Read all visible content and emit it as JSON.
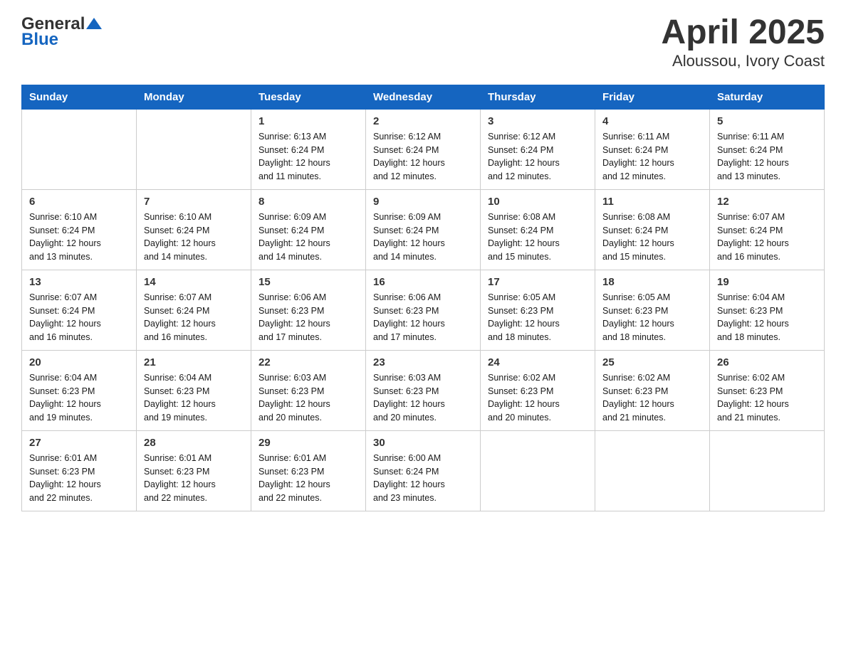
{
  "header": {
    "logo_general": "General",
    "logo_blue": "Blue",
    "title": "April 2025",
    "subtitle": "Aloussou, Ivory Coast"
  },
  "days_of_week": [
    "Sunday",
    "Monday",
    "Tuesday",
    "Wednesday",
    "Thursday",
    "Friday",
    "Saturday"
  ],
  "weeks": [
    [
      {
        "day": "",
        "info": ""
      },
      {
        "day": "",
        "info": ""
      },
      {
        "day": "1",
        "info": "Sunrise: 6:13 AM\nSunset: 6:24 PM\nDaylight: 12 hours\nand 11 minutes."
      },
      {
        "day": "2",
        "info": "Sunrise: 6:12 AM\nSunset: 6:24 PM\nDaylight: 12 hours\nand 12 minutes."
      },
      {
        "day": "3",
        "info": "Sunrise: 6:12 AM\nSunset: 6:24 PM\nDaylight: 12 hours\nand 12 minutes."
      },
      {
        "day": "4",
        "info": "Sunrise: 6:11 AM\nSunset: 6:24 PM\nDaylight: 12 hours\nand 12 minutes."
      },
      {
        "day": "5",
        "info": "Sunrise: 6:11 AM\nSunset: 6:24 PM\nDaylight: 12 hours\nand 13 minutes."
      }
    ],
    [
      {
        "day": "6",
        "info": "Sunrise: 6:10 AM\nSunset: 6:24 PM\nDaylight: 12 hours\nand 13 minutes."
      },
      {
        "day": "7",
        "info": "Sunrise: 6:10 AM\nSunset: 6:24 PM\nDaylight: 12 hours\nand 14 minutes."
      },
      {
        "day": "8",
        "info": "Sunrise: 6:09 AM\nSunset: 6:24 PM\nDaylight: 12 hours\nand 14 minutes."
      },
      {
        "day": "9",
        "info": "Sunrise: 6:09 AM\nSunset: 6:24 PM\nDaylight: 12 hours\nand 14 minutes."
      },
      {
        "day": "10",
        "info": "Sunrise: 6:08 AM\nSunset: 6:24 PM\nDaylight: 12 hours\nand 15 minutes."
      },
      {
        "day": "11",
        "info": "Sunrise: 6:08 AM\nSunset: 6:24 PM\nDaylight: 12 hours\nand 15 minutes."
      },
      {
        "day": "12",
        "info": "Sunrise: 6:07 AM\nSunset: 6:24 PM\nDaylight: 12 hours\nand 16 minutes."
      }
    ],
    [
      {
        "day": "13",
        "info": "Sunrise: 6:07 AM\nSunset: 6:24 PM\nDaylight: 12 hours\nand 16 minutes."
      },
      {
        "day": "14",
        "info": "Sunrise: 6:07 AM\nSunset: 6:24 PM\nDaylight: 12 hours\nand 16 minutes."
      },
      {
        "day": "15",
        "info": "Sunrise: 6:06 AM\nSunset: 6:23 PM\nDaylight: 12 hours\nand 17 minutes."
      },
      {
        "day": "16",
        "info": "Sunrise: 6:06 AM\nSunset: 6:23 PM\nDaylight: 12 hours\nand 17 minutes."
      },
      {
        "day": "17",
        "info": "Sunrise: 6:05 AM\nSunset: 6:23 PM\nDaylight: 12 hours\nand 18 minutes."
      },
      {
        "day": "18",
        "info": "Sunrise: 6:05 AM\nSunset: 6:23 PM\nDaylight: 12 hours\nand 18 minutes."
      },
      {
        "day": "19",
        "info": "Sunrise: 6:04 AM\nSunset: 6:23 PM\nDaylight: 12 hours\nand 18 minutes."
      }
    ],
    [
      {
        "day": "20",
        "info": "Sunrise: 6:04 AM\nSunset: 6:23 PM\nDaylight: 12 hours\nand 19 minutes."
      },
      {
        "day": "21",
        "info": "Sunrise: 6:04 AM\nSunset: 6:23 PM\nDaylight: 12 hours\nand 19 minutes."
      },
      {
        "day": "22",
        "info": "Sunrise: 6:03 AM\nSunset: 6:23 PM\nDaylight: 12 hours\nand 20 minutes."
      },
      {
        "day": "23",
        "info": "Sunrise: 6:03 AM\nSunset: 6:23 PM\nDaylight: 12 hours\nand 20 minutes."
      },
      {
        "day": "24",
        "info": "Sunrise: 6:02 AM\nSunset: 6:23 PM\nDaylight: 12 hours\nand 20 minutes."
      },
      {
        "day": "25",
        "info": "Sunrise: 6:02 AM\nSunset: 6:23 PM\nDaylight: 12 hours\nand 21 minutes."
      },
      {
        "day": "26",
        "info": "Sunrise: 6:02 AM\nSunset: 6:23 PM\nDaylight: 12 hours\nand 21 minutes."
      }
    ],
    [
      {
        "day": "27",
        "info": "Sunrise: 6:01 AM\nSunset: 6:23 PM\nDaylight: 12 hours\nand 22 minutes."
      },
      {
        "day": "28",
        "info": "Sunrise: 6:01 AM\nSunset: 6:23 PM\nDaylight: 12 hours\nand 22 minutes."
      },
      {
        "day": "29",
        "info": "Sunrise: 6:01 AM\nSunset: 6:23 PM\nDaylight: 12 hours\nand 22 minutes."
      },
      {
        "day": "30",
        "info": "Sunrise: 6:00 AM\nSunset: 6:24 PM\nDaylight: 12 hours\nand 23 minutes."
      },
      {
        "day": "",
        "info": ""
      },
      {
        "day": "",
        "info": ""
      },
      {
        "day": "",
        "info": ""
      }
    ]
  ]
}
